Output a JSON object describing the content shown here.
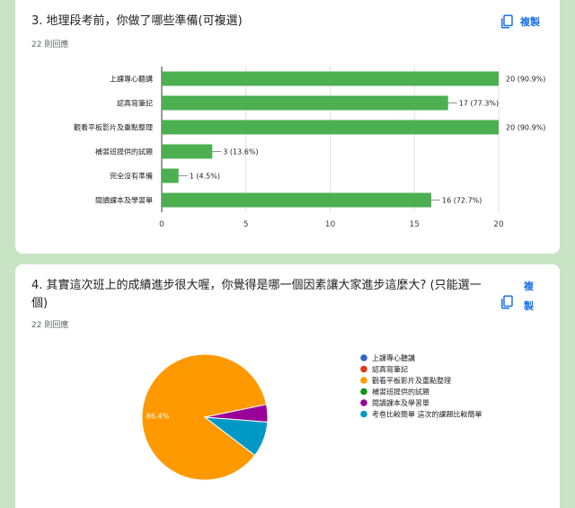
{
  "question1": {
    "title": "3. 地理段考前，你做了哪些準備(可複選)",
    "responses": "22 則回應",
    "copy_label": "複製"
  },
  "question2": {
    "title_line1": "4. 其實這次班上的成績進步很大喔，你覺得是哪一個因素讓大家進步這麼大? (只能選一",
    "title_line2": "個)",
    "responses": "22 則回應",
    "copy_label_1": "複",
    "copy_label_2": "製"
  },
  "colors": {
    "bar": "#4caf50",
    "accent": "#1a73e8",
    "pie": [
      "#3366cc",
      "#dc3912",
      "#ff9900",
      "#109618",
      "#990099",
      "#0099c6"
    ]
  },
  "chart_data": [
    {
      "type": "bar",
      "orientation": "horizontal",
      "categories": [
        "上課專心聽講",
        "認真寫筆記",
        "觀看平板影片及重點整理",
        "補習班提供的試題",
        "完全沒有準備",
        "閱讀課本及學習單"
      ],
      "values": [
        20,
        17,
        20,
        3,
        1,
        16
      ],
      "value_labels": [
        "20 (90.9%)",
        "17 (77.3%)",
        "20 (90.9%)",
        "3 (13.6%)",
        "1 (4.5%)",
        "16 (72.7%)"
      ],
      "xlim": [
        0,
        20
      ],
      "xticks": [
        "0",
        "5",
        "10",
        "15",
        "20"
      ],
      "grid": true
    },
    {
      "type": "pie",
      "labels": [
        "上課專心聽講",
        "認真寫筆記",
        "觀看平板影片及重點整理",
        "補習班提供的試題",
        "閱讀課本及學習單",
        "考卷比較簡單 這次的課題比較簡單"
      ],
      "values": [
        0,
        0,
        86.4,
        0,
        4.5,
        9.1
      ],
      "slice_labels": [
        "",
        "",
        "86.4%",
        "",
        "",
        ""
      ],
      "legend_position": "right"
    }
  ]
}
